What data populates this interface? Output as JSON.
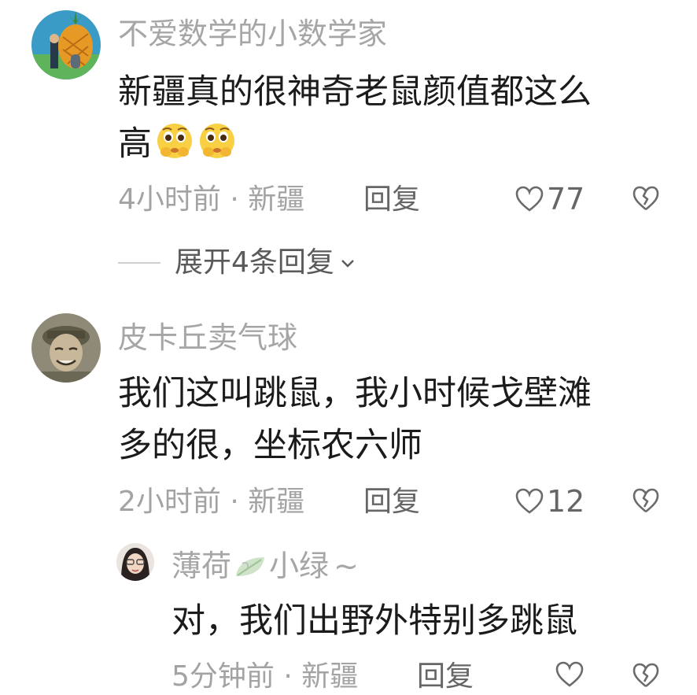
{
  "comments": [
    {
      "username": "不爱数学的小数学家",
      "content_line1": "新疆真的很神奇老鼠颜值都这么",
      "content_line2": "高",
      "emoji": "pleading-face-with-hands-emoji",
      "time_location": "4小时前 · 新疆",
      "reply_label": "回复",
      "likes": "77",
      "expand_label": "展开4条回复"
    },
    {
      "username": "皮卡丘卖气球",
      "content_line1": "我们这叫跳鼠，我小时候戈壁滩",
      "content_line2": "多的很，坐标农六师",
      "time_location": "2小时前 · 新疆",
      "reply_label": "回复",
      "likes": "12"
    }
  ],
  "reply": {
    "username_prefix": "薄荷",
    "username_suffix": "小绿",
    "username_tilde": "~",
    "content": "对，我们出野外特别多跳鼠",
    "time_location": "5分钟前 · 新疆",
    "reply_label": "回复"
  },
  "icons": {
    "like": "heart-outline-icon",
    "dislike": "broken-heart-icon",
    "expand": "chevron-down-icon",
    "leaf": "leaf-emoji"
  },
  "colors": {
    "username": "#a6a6a6",
    "content": "#1b1b1b",
    "meta": "#a3a3a3",
    "action": "#666666"
  }
}
